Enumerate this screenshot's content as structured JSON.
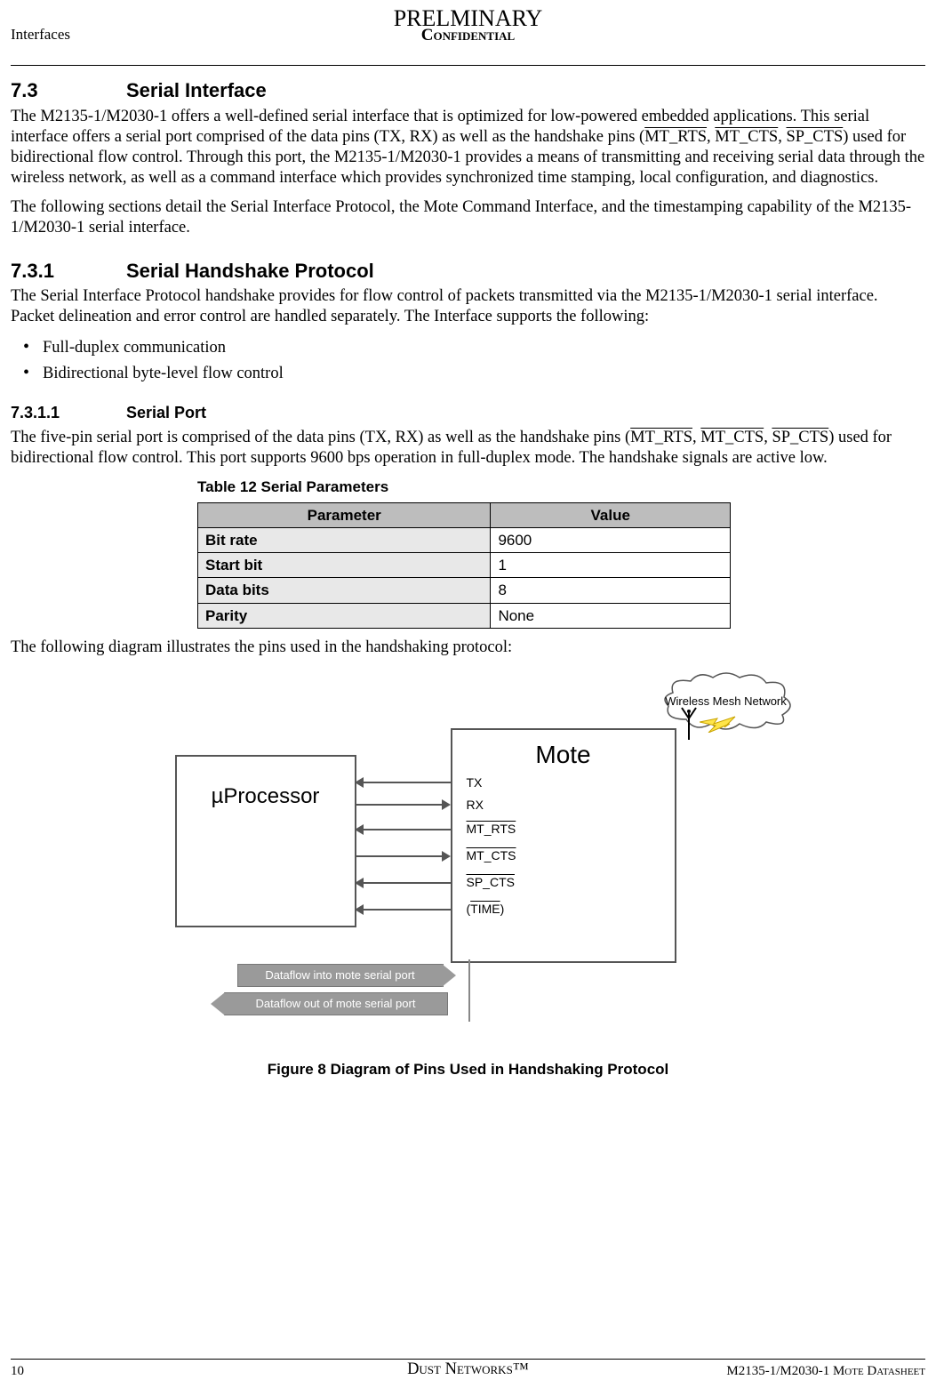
{
  "header": {
    "watermark": "PRELMINARY",
    "left": "Interfaces",
    "center": "Confidential"
  },
  "section_7_3": {
    "num": "7.3",
    "title": "Serial Interface",
    "para1_a": "The M2135-1/M2030-1 offers a well-defined serial interface that is optimized for low-powered embedded applications. This serial interface offers a serial port comprised of the data pins (TX, RX) as well as the handshake pins (",
    "pin1": "MT_RTS",
    "pin2": "MT_CTS",
    "pin3": "SP_CTS",
    "para1_b": ") used for bidirectional flow control. Through this port, the M2135-1/M2030-1 provides a means of transmitting and receiving serial data through the wireless network, as well as a command interface which provides synchronized time stamping, local configuration, and diagnostics.",
    "para2": "The following sections detail the Serial Interface Protocol, the Mote Command Interface, and the timestamping capability of the M2135-1/M2030-1 serial interface."
  },
  "section_7_3_1": {
    "num": "7.3.1",
    "title": "Serial Handshake Protocol",
    "para": "The Serial Interface Protocol handshake provides for flow control of packets transmitted via the M2135-1/M2030-1 serial interface. Packet delineation and error control are handled separately. The Interface supports the following:",
    "bullets": [
      "Full-duplex communication",
      "Bidirectional byte-level flow control"
    ]
  },
  "section_7_3_1_1": {
    "num": "7.3.1.1",
    "title": "Serial Port",
    "para_a": "The five-pin serial port is comprised of the data pins (TX, RX) as well as the handshake pins (",
    "pin1": "MT_RTS",
    "pin2": "MT_CTS",
    "pin3": "SP_CTS",
    "para_b": ") used for bidirectional flow control. This port supports 9600 bps operation in full-duplex mode. The handshake signals are active low."
  },
  "table12": {
    "caption": "Table 12    Serial Parameters",
    "head_param": "Parameter",
    "head_value": "Value",
    "rows": [
      {
        "param": "Bit rate",
        "value": "9600"
      },
      {
        "param": "Start bit",
        "value": "1"
      },
      {
        "param": "Data bits",
        "value": "8"
      },
      {
        "param": "Parity",
        "value": "None"
      }
    ]
  },
  "post_table_para": "The following diagram illustrates the pins used in the handshaking protocol:",
  "figure8": {
    "caption": "Figure 8    Diagram of Pins Used in Handshaking Protocol",
    "uproc": "µProcessor",
    "mote": "Mote",
    "cloud": "Wireless Mesh Network",
    "signals": [
      "TX",
      "RX",
      "MT_RTS",
      "MT_CTS",
      "SP_CTS",
      "(TIME)"
    ],
    "flow_in": "Dataflow into mote serial port",
    "flow_out": "Dataflow out of mote serial port"
  },
  "footer": {
    "page": "10",
    "center": "Dust Networks™",
    "right": "M2135-1/M2030-1 Mote Datasheet"
  }
}
